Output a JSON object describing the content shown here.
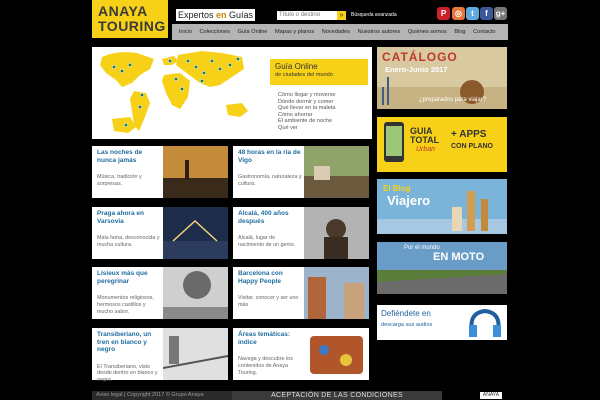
{
  "brand": {
    "line1": "ANAYA",
    "line2": "TOURING"
  },
  "tagline": {
    "pre": "Expertos ",
    "accent": "en",
    "post": " Guías"
  },
  "search": {
    "placeholder": "Título o destino",
    "button": "»",
    "advanced": "Búsqueda avanzada"
  },
  "social": [
    {
      "name": "pinterest-icon",
      "glyph": "P",
      "color": "#cb2027"
    },
    {
      "name": "instagram-icon",
      "glyph": "◎",
      "color": "#e8753a"
    },
    {
      "name": "twitter-icon",
      "glyph": "t",
      "color": "#5ea9dd"
    },
    {
      "name": "facebook-icon",
      "glyph": "f",
      "color": "#3b5998"
    },
    {
      "name": "googleplus-icon",
      "glyph": "g+",
      "color": "#777777"
    }
  ],
  "nav": [
    "Inicio",
    "Colecciones",
    "Guía Online",
    "Mapas y planos",
    "Novedades",
    "Nuestros autores",
    "Quiénes somos",
    "Blog",
    "Contacto"
  ],
  "guide": {
    "title": "Guía Online",
    "subtitle": "de ciudades del mundo",
    "links": [
      "Cómo llegar y moverse",
      "Dónde dormir y comer",
      "Qué llevar en la maleta",
      "Cómo ahorrar",
      "El ambiente de noche",
      "Qué ver"
    ]
  },
  "cards": [
    {
      "title": "Las noches de nunca jamás",
      "desc": "Música, tradición y sorpresas."
    },
    {
      "title": "48 horas en la ría de Vigo",
      "desc": "Gastronomía, naturaleza y cultura."
    },
    {
      "title": "Praga ahora en Varsovia",
      "desc": "Mala fama, desconocida y mucha cultura."
    },
    {
      "title": "Alcalá, 400 años después",
      "desc": "Alcalá, lugar de nacimiento de un genio."
    },
    {
      "title": "Lisieux más que peregrinar",
      "desc": "Monumentos religiosos, hermosos castillos y mucho sabor."
    },
    {
      "title": "Barcelona con Happy People",
      "desc": "Visitar, conocer y ser uno más"
    },
    {
      "title": "Transiberiano, un tren en blanco y negro",
      "desc": "El Transiberiano, visto desde dentro en blanco y negro."
    },
    {
      "title": "Áreas temáticas: índice",
      "desc": "Navega y descubre los contenidos de Anaya Touring."
    }
  ],
  "ads": {
    "catalogo": {
      "title": "CATÁLOGO",
      "sub": "Enero-Junio 2017",
      "q": "¿preparados para viajar?"
    },
    "apps": {
      "g1": "GUIA",
      "g2": "TOTAL",
      "g3": "Urban",
      "a1": "+ APPS",
      "a2": "CON PLANO"
    },
    "blog": {
      "l1": "El Blog",
      "l2": "Viajero"
    },
    "moto": {
      "l1": "Por el mundo",
      "l2": "EN MOTO"
    },
    "audio": {
      "l1": "Defiéndete en",
      "l2": "descarga sus audios"
    }
  },
  "footer": {
    "text": "Aviso legal | Copyright 2017 © Grupo Anaya",
    "accept": "ACEPTACIÓN DE LAS CONDICIONES",
    "logo": "ANAYA"
  }
}
